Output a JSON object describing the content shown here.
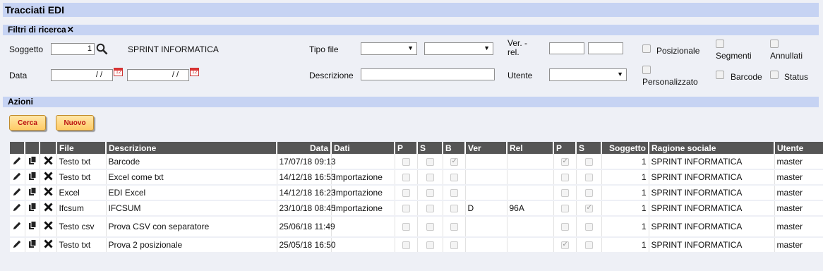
{
  "page_title": "Tracciati EDI",
  "filters": {
    "section_title": "Filtri di ricerca",
    "soggetto_label": "Soggetto",
    "soggetto_value": "1",
    "soggetto_name": "SPRINT INFORMATICA",
    "data_label": "Data",
    "date_from": "/ /",
    "date_to": "/ /",
    "calendar_glyph": "12",
    "tipo_file_label": "Tipo file",
    "descrizione_label": "Descrizione",
    "ver_rel_label_1": "Ver. -",
    "ver_rel_label_2": "rel.",
    "utente_label": "Utente",
    "chk_posizionale": "Posizionale",
    "chk_segmenti": "Segmenti",
    "chk_annullati": "Annullati",
    "chk_personalizzato": "Personalizzato",
    "chk_barcode": "Barcode",
    "chk_status": "Status"
  },
  "actions": {
    "section_title": "Azioni",
    "search_label": "Cerca",
    "new_label": "Nuovo"
  },
  "table": {
    "headers": [
      "File",
      "Descrizione",
      "Data",
      "Dati",
      "P",
      "S",
      "B",
      "Ver",
      "Rel",
      "P",
      "S",
      "Soggetto",
      "Ragione sociale",
      "Utente"
    ],
    "rows": [
      {
        "file": "Testo txt",
        "descrizione": "Barcode",
        "data": "17/07/18 09:13",
        "dati": "",
        "p1": false,
        "s1": false,
        "b": true,
        "ver": "",
        "rel": "",
        "p2": true,
        "s2": false,
        "soggetto": "1",
        "ragione": "SPRINT INFORMATICA",
        "utente": "master"
      },
      {
        "file": "Testo txt",
        "descrizione": "Excel come txt",
        "data": "14/12/18 16:53",
        "dati": "Importazione",
        "p1": false,
        "s1": false,
        "b": false,
        "ver": "",
        "rel": "",
        "p2": false,
        "s2": false,
        "soggetto": "1",
        "ragione": "SPRINT INFORMATICA",
        "utente": "master"
      },
      {
        "file": "Excel",
        "descrizione": "EDI Excel",
        "data": "14/12/18 16:23",
        "dati": "Importazione",
        "p1": false,
        "s1": false,
        "b": false,
        "ver": "",
        "rel": "",
        "p2": false,
        "s2": false,
        "soggetto": "1",
        "ragione": "SPRINT INFORMATICA",
        "utente": "master"
      },
      {
        "file": "Ifcsum",
        "descrizione": "IFCSUM",
        "data": "23/10/18 08:45",
        "dati": "Importazione",
        "p1": false,
        "s1": false,
        "b": false,
        "ver": "D",
        "rel": "96A",
        "p2": false,
        "s2": true,
        "soggetto": "1",
        "ragione": "SPRINT INFORMATICA",
        "utente": "master"
      },
      {
        "file": "Testo csv",
        "descrizione": "Prova CSV con separatore",
        "data": "25/06/18 11:49",
        "dati": "",
        "p1": false,
        "s1": false,
        "b": false,
        "ver": "",
        "rel": "",
        "p2": false,
        "s2": false,
        "soggetto": "1",
        "ragione": "SPRINT INFORMATICA",
        "utente": "master"
      },
      {
        "file": "Testo txt",
        "descrizione": "Prova 2 posizionale",
        "data": "25/05/18 16:50",
        "dati": "",
        "p1": false,
        "s1": false,
        "b": false,
        "ver": "",
        "rel": "",
        "p2": true,
        "s2": false,
        "soggetto": "1",
        "ragione": "SPRINT INFORMATICA",
        "utente": "master"
      }
    ]
  },
  "icons": {
    "edit": "pencil-icon",
    "copy": "copy-icon",
    "delete": "delete-icon",
    "search": "magnifier-icon",
    "close": "close-icon",
    "calendar": "calendar-icon"
  },
  "colors": {
    "bar": "#c6d3f3",
    "header": "#555555",
    "button": "#ffcb66",
    "button_text": "#bb1111"
  }
}
